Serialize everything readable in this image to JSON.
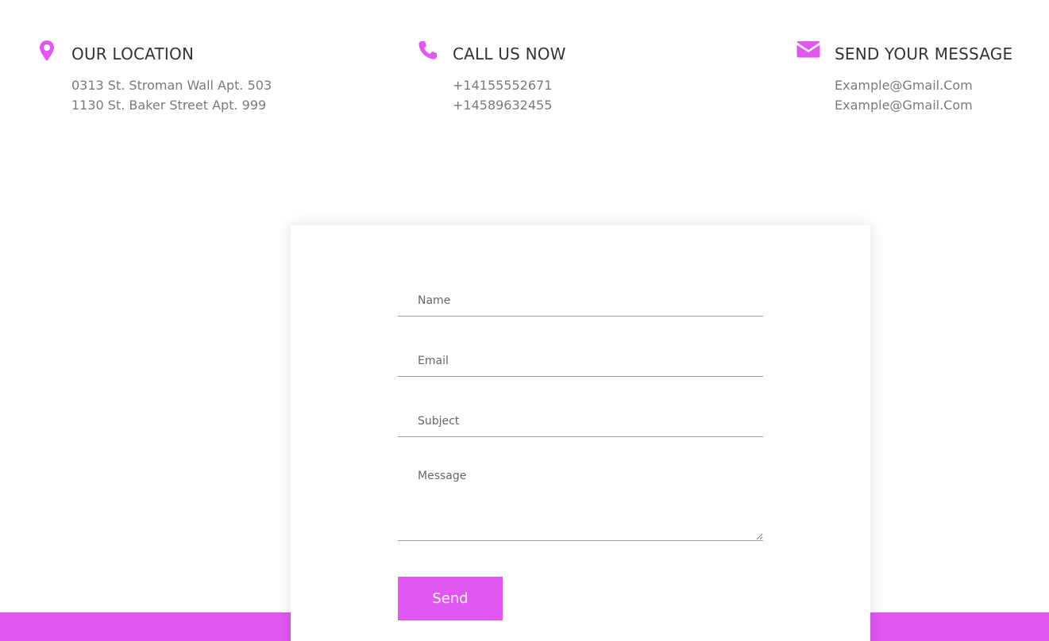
{
  "colors": {
    "accent": "#e256f2",
    "heading": "#333333",
    "body_text": "#7a7a7a"
  },
  "contact": {
    "location": {
      "icon": "map-pin-icon",
      "title": "OUR LOCATION",
      "lines": [
        "0313 St. Stroman Wall Apt. 503",
        "1130 St. Baker Street Apt. 999"
      ]
    },
    "phone": {
      "icon": "phone-icon",
      "title": "CALL US NOW",
      "lines": [
        "+14155552671",
        "+14589632455"
      ]
    },
    "email": {
      "icon": "envelope-icon",
      "title": "SEND YOUR MESSAGE",
      "lines": [
        "Example@Gmail.Com",
        "Example@Gmail.Com"
      ]
    }
  },
  "form": {
    "name_placeholder": "Name",
    "email_placeholder": "Email",
    "subject_placeholder": "Subject",
    "message_placeholder": "Message",
    "send_label": "Send"
  }
}
